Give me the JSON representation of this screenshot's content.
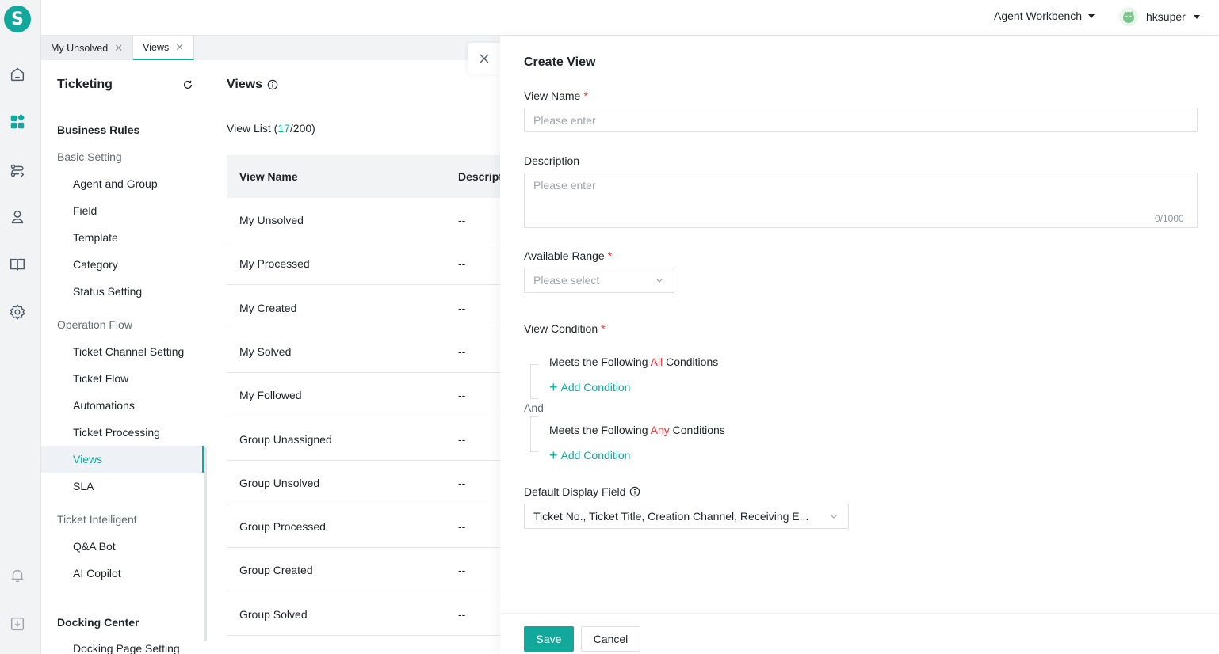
{
  "app": {
    "logo_letter": "S",
    "workbench_label": "Agent Workbench",
    "user_name": "hksuper"
  },
  "tabs": [
    {
      "label": "My Unsolved",
      "active": false
    },
    {
      "label": "Views",
      "active": true
    }
  ],
  "sidebar": {
    "title": "Ticketing",
    "items": [
      {
        "label": "Business Rules",
        "level": 0
      },
      {
        "label": "Basic Setting",
        "level": 1
      },
      {
        "label": "Agent and Group",
        "level": 2
      },
      {
        "label": "Field",
        "level": 2
      },
      {
        "label": "Template",
        "level": 2
      },
      {
        "label": "Category",
        "level": 2
      },
      {
        "label": "Status Setting",
        "level": 2
      },
      {
        "label": "Operation Flow",
        "level": 1
      },
      {
        "label": "Ticket Channel Setting",
        "level": 2
      },
      {
        "label": "Ticket Flow",
        "level": 2
      },
      {
        "label": "Automations",
        "level": 2
      },
      {
        "label": "Ticket Processing",
        "level": 2
      },
      {
        "label": "Views",
        "level": 2,
        "active": true
      },
      {
        "label": "SLA",
        "level": 2
      },
      {
        "label": "Ticket Intelligent",
        "level": 1
      },
      {
        "label": "Q&A Bot",
        "level": 2
      },
      {
        "label": "AI Copilot",
        "level": 2
      },
      {
        "label": "Docking Center",
        "level": 0
      },
      {
        "label": "Docking Page Setting",
        "level": 2
      }
    ]
  },
  "main": {
    "title": "Views",
    "count_prefix": "View List (",
    "count_current": "17",
    "count_total": "/200)",
    "columns": [
      "View Name",
      "Descripti"
    ],
    "rows": [
      {
        "name": "My Unsolved",
        "desc": "--"
      },
      {
        "name": "My Processed",
        "desc": "--"
      },
      {
        "name": "My Created",
        "desc": "--"
      },
      {
        "name": "My Solved",
        "desc": "--"
      },
      {
        "name": "My Followed",
        "desc": "--"
      },
      {
        "name": "Group Unassigned",
        "desc": "--"
      },
      {
        "name": "Group Unsolved",
        "desc": "--"
      },
      {
        "name": "Group Processed",
        "desc": "--"
      },
      {
        "name": "Group Created",
        "desc": "--"
      },
      {
        "name": "Group Solved",
        "desc": "--"
      }
    ]
  },
  "drawer": {
    "title": "Create View",
    "view_name_label": "View Name",
    "view_name_value": "",
    "view_name_placeholder": "Please enter",
    "description_label": "Description",
    "description_value": "",
    "description_placeholder": "Please enter",
    "description_counter": "0/1000",
    "range_label": "Available Range",
    "range_placeholder": "Please select",
    "condition_label": "View Condition",
    "all_prefix": "Meets the Following ",
    "all_word": "All",
    "all_suffix": " Conditions",
    "any_prefix": "Meets the Following ",
    "any_word": "Any",
    "any_suffix": " Conditions",
    "add_condition": "Add Condition",
    "and_label": "And",
    "display_field_label": "Default Display Field",
    "display_field_value": "Ticket No., Ticket Title, Creation Channel, Receiving E...",
    "save_label": "Save",
    "cancel_label": "Cancel"
  },
  "colors": {
    "accent": "#12a89c",
    "required": "#e63b3b"
  }
}
